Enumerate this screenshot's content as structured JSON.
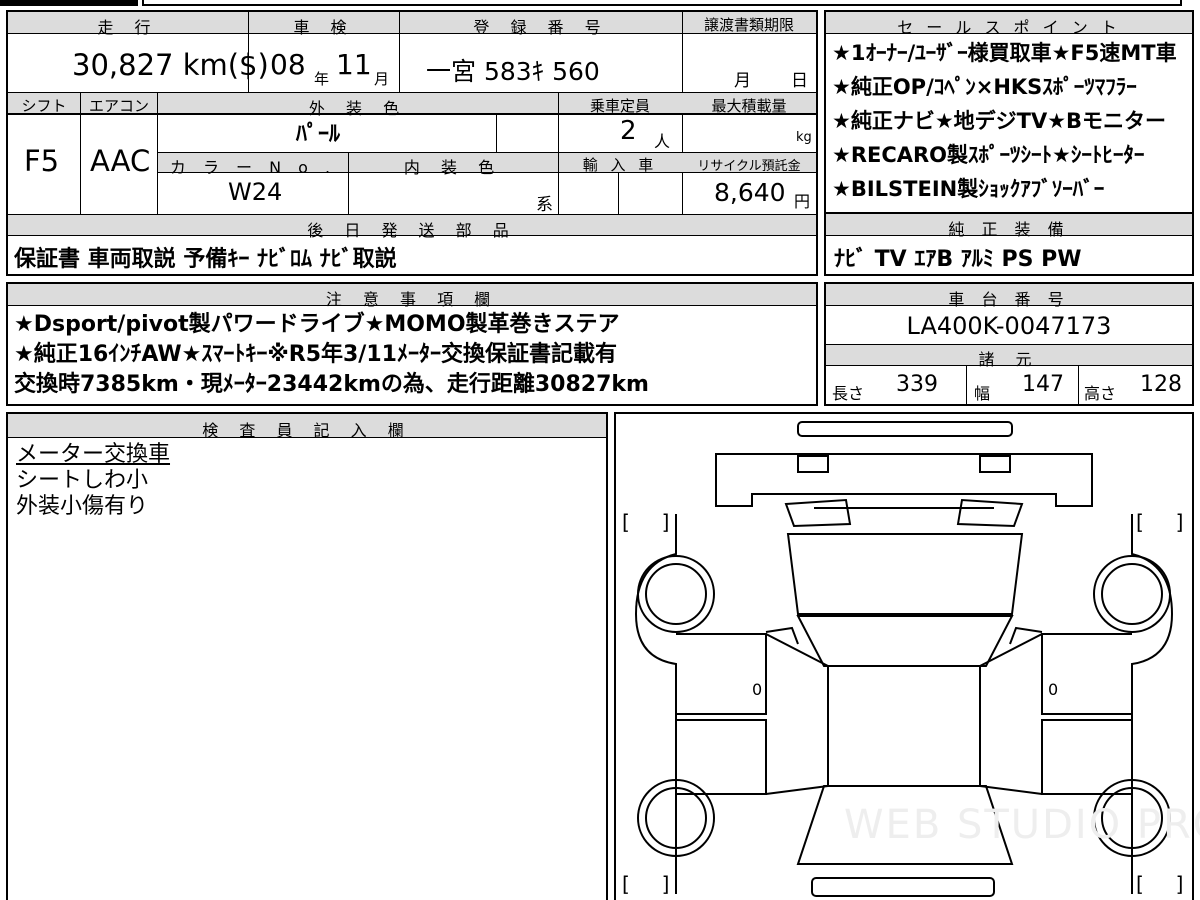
{
  "headers": {
    "mileage": "走 行",
    "inspection": "車 検",
    "registration": "登 録 番 号",
    "transfer_deadline": "譲渡書類期限",
    "sales_points": "セ ー ル ス ポ イ ン ト",
    "shift": "シフト",
    "aircon": "エアコン",
    "exterior_color": "外 装 色",
    "capacity": "乗車定員",
    "max_load": "最大積載量",
    "color_no": "カ ラ ー N o .",
    "interior_color": "内 装 色",
    "import": "輸 入 車",
    "recycle": "リサイクル預託金",
    "later_parts": "後 日 発 送 部 品",
    "genuine_equipment": "純 正 装 備",
    "notes": "注 意 事 項 欄",
    "chassis_no": "車 台 番 号",
    "specs": "諸 元",
    "inspector": "検 査 員 記 入 欄"
  },
  "vehicle": {
    "mileage": "30,827 km($)",
    "inspection_year": "08",
    "inspection_year_unit": "年",
    "inspection_month": "11",
    "inspection_month_unit": "月",
    "registration_no": "一宮 583ｷ 560",
    "transfer_month_unit": "月",
    "transfer_day_unit": "日",
    "shift": "F5",
    "aircon": "AAC",
    "exterior_color": "ﾊﾟｰﾙ",
    "capacity": "2",
    "capacity_unit": "人",
    "max_load_unit": "kg",
    "color_no": "W24",
    "interior_suffix": "系",
    "recycle_fee": "8,640",
    "recycle_unit": "円",
    "chassis_no": "LA400K-0047173",
    "length_label": "長さ",
    "length": "339",
    "width_label": "幅",
    "width": "147",
    "height_label": "高さ",
    "height": "128"
  },
  "sales_points": [
    "★1ｵｰﾅｰ/ﾕｰｻﾞｰ様買取車★F5速MT車",
    "★純正OP/ｺﾍﾟﾝ×HKSｽﾎﾟｰﾂﾏﾌﾗｰ",
    "★純正ナビ★地デジTV★Bモニター",
    "★RECARO製ｽﾎﾟｰﾂｼｰﾄ★ｼｰﾄﾋｰﾀｰ",
    "★BILSTEIN製ｼｮｯｸｱﾌﾞｿｰﾊﾞｰ"
  ],
  "later_parts": "保証書 車両取説 予備ｷｰ ﾅﾋﾞﾛﾑ ﾅﾋﾞ取説",
  "genuine_equipment": "ﾅﾋﾞ TV ｴｱB ｱﾙﾐ PS PW",
  "notes": [
    "★Dsport/pivot製パワードライブ★MOMO製革巻きステア",
    "★純正16ｲﾝﾁAW★ｽﾏｰﾄｷｰ※R5年3/11ﾒｰﾀｰ交換保証書記載有",
    "交換時7385km・現ﾒｰﾀｰ23442kmの為、走行距離30827km"
  ],
  "inspector_notes": [
    "メーター交換車",
    "シートしわ小",
    "外装小傷有り"
  ],
  "diagram": {
    "bracket_open": "[",
    "bracket_close": "]",
    "left_door_mark": "0",
    "right_door_mark": "0",
    "watermark": "WEB STUDIO PRO"
  }
}
